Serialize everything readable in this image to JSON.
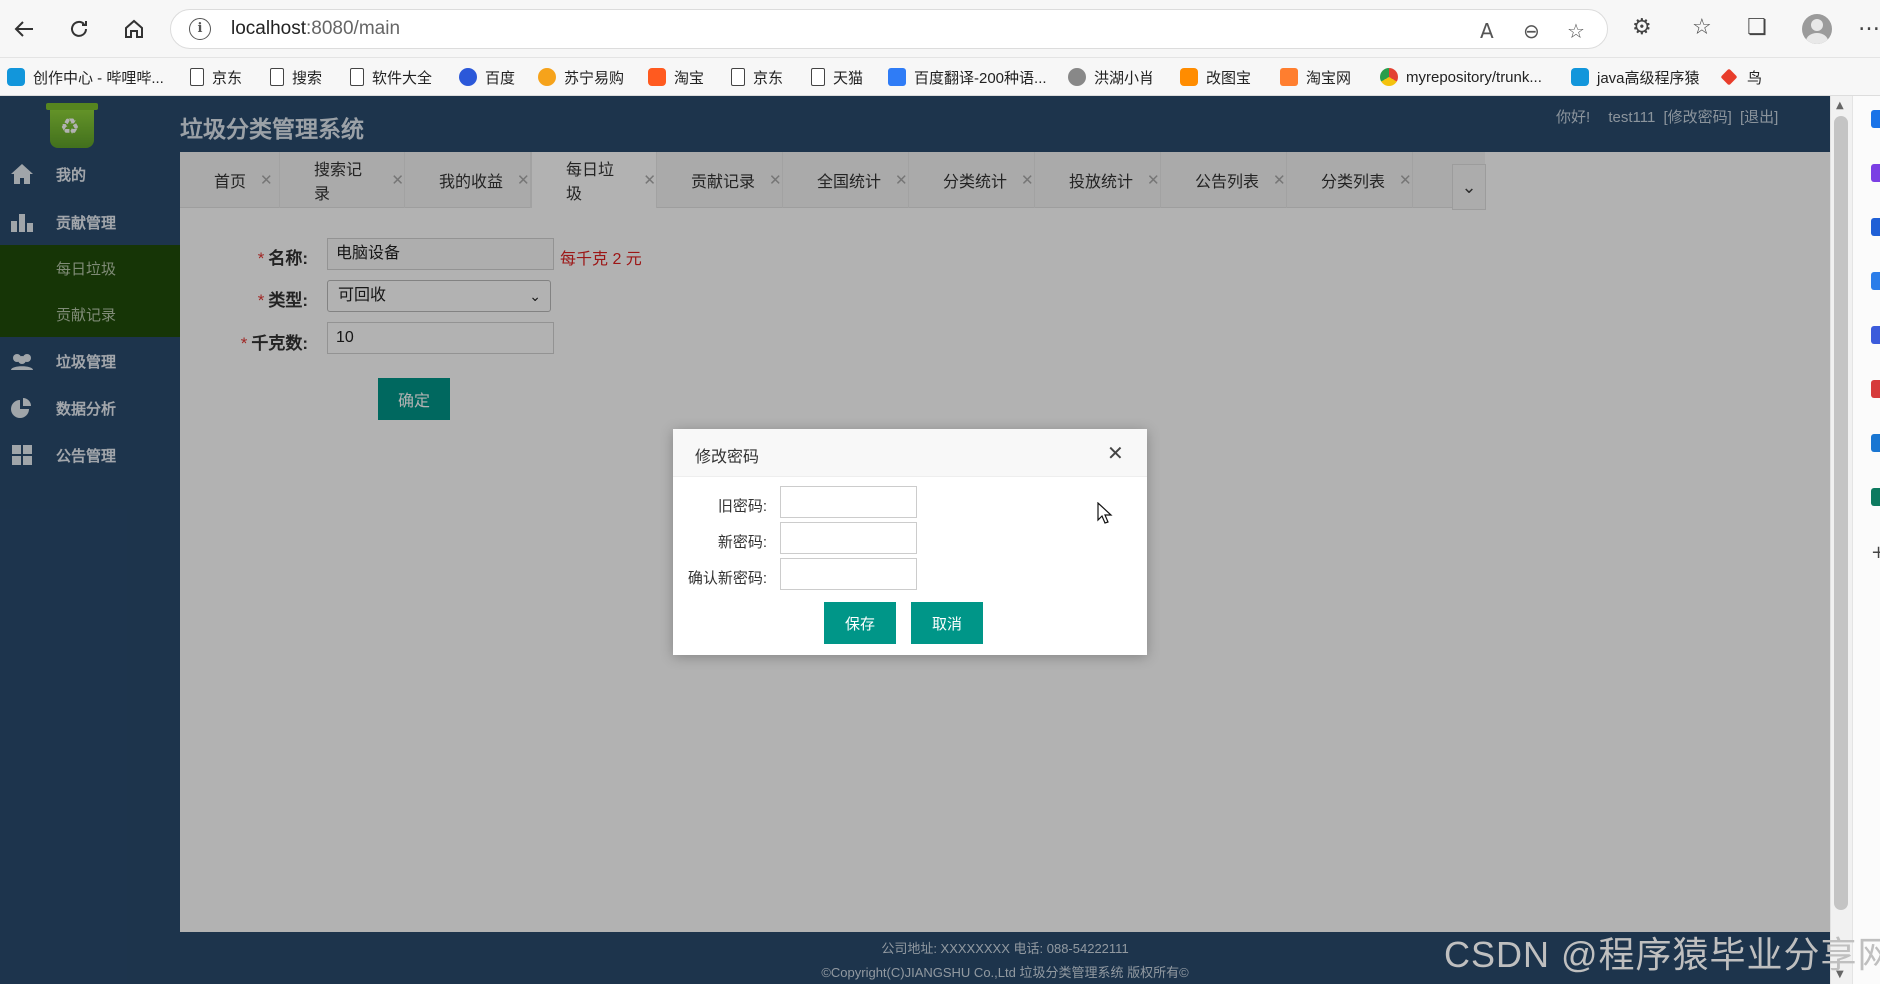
{
  "browser": {
    "url_host": "localhost",
    "url_rest": ":8080/main",
    "bookmarks": [
      {
        "label": "创作中心 - 哔哩哔...",
        "icon": "bilibili-icon"
      },
      {
        "label": "京东",
        "icon": "page-icon"
      },
      {
        "label": "搜索",
        "icon": "page-icon"
      },
      {
        "label": "软件大全",
        "icon": "page-icon"
      },
      {
        "label": "百度",
        "icon": "baidu-icon"
      },
      {
        "label": "苏宁易购",
        "icon": "suning-icon"
      },
      {
        "label": "淘宝",
        "icon": "taobao-icon"
      },
      {
        "label": "京东",
        "icon": "page-icon"
      },
      {
        "label": "天猫",
        "icon": "page-icon"
      },
      {
        "label": "百度翻译-200种语...",
        "icon": "fanyi-icon"
      },
      {
        "label": "洪湖小肖",
        "icon": "honghu-icon"
      },
      {
        "label": "改图宝",
        "icon": "gaitubao-icon"
      },
      {
        "label": "淘宝网",
        "icon": "taobao-icon"
      },
      {
        "label": "myrepository/trunk...",
        "icon": "chrome-icon"
      },
      {
        "label": "java高级程序猿",
        "icon": "bilibili-icon"
      },
      {
        "label": "鸟",
        "icon": "bird-icon"
      }
    ]
  },
  "app": {
    "title": "垃圾分类管理系统",
    "user": {
      "greeting": "你好!",
      "name": "test111",
      "change_pwd": "[修改密码]",
      "logout": "[退出]"
    },
    "sidebar": {
      "items": [
        {
          "label": "我的",
          "icon": "home-icon"
        },
        {
          "label": "贡献管理",
          "icon": "bar-chart-icon"
        },
        {
          "label": "垃圾管理",
          "icon": "users-icon"
        },
        {
          "label": "数据分析",
          "icon": "pie-chart-icon"
        },
        {
          "label": "公告管理",
          "icon": "grid-icon"
        }
      ],
      "subitems": [
        "每日垃圾",
        "贡献记录"
      ]
    },
    "tabs": [
      "首页",
      "搜索记录",
      "我的收益",
      "每日垃圾",
      "贡献记录",
      "全国统计",
      "分类统计",
      "投放统计",
      "公告列表",
      "分类列表"
    ],
    "active_tab": "每日垃圾",
    "form": {
      "name_label": "名称:",
      "name_value": "电脑设备",
      "price_hint": "每千克 2 元",
      "type_label": "类型:",
      "type_value": "可回收",
      "weight_label": "千克数:",
      "weight_value": "10",
      "submit_label": "确定"
    },
    "footer": {
      "line1": "公司地址: XXXXXXXX 电话: 088-54222111",
      "line2": "©Copyright(C)JIANGSHU Co.,Ltd 垃圾分类管理系统 版权所有©"
    },
    "watermark": "CSDN @程序猿毕业分享网"
  },
  "dialog": {
    "title": "修改密码",
    "old_label": "旧密码:",
    "new_label": "新密码:",
    "confirm_label": "确认新密码:",
    "old_value": "",
    "new_value": "",
    "confirm_value": "",
    "save_label": "保存",
    "cancel_label": "取消"
  },
  "colors": {
    "sidebar": "#2a4b6e",
    "submenu": "#204d0a",
    "primary_button": "#009688",
    "required_star": "#e53935",
    "hint": "#e02020"
  }
}
